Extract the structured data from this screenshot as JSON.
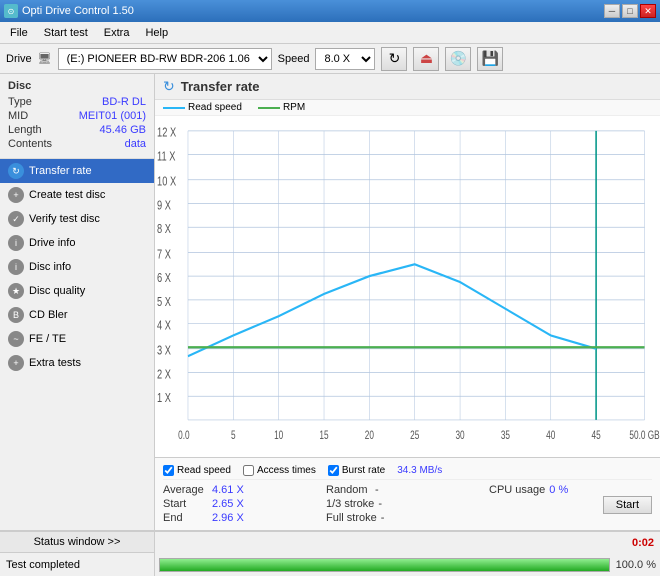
{
  "titlebar": {
    "title": "Opti Drive Control 1.50",
    "icon": "ODC",
    "minimize": "─",
    "restore": "□",
    "close": "✕"
  },
  "menu": {
    "items": [
      "File",
      "Start test",
      "Extra",
      "Help"
    ]
  },
  "drivebar": {
    "drive_label": "Drive",
    "drive_value": "(E:)  PIONEER BD-RW  BDR-206 1.06",
    "speed_label": "Speed",
    "speed_value": "8.0 X"
  },
  "disc": {
    "title": "Disc",
    "type_label": "Type",
    "type_value": "BD-R DL",
    "mid_label": "MID",
    "mid_value": "MEIT01 (001)",
    "length_label": "Length",
    "length_value": "45.46 GB",
    "contents_label": "Contents",
    "contents_value": "data"
  },
  "nav": {
    "items": [
      {
        "label": "Transfer rate",
        "active": true
      },
      {
        "label": "Create test disc",
        "active": false
      },
      {
        "label": "Verify test disc",
        "active": false
      },
      {
        "label": "Drive info",
        "active": false
      },
      {
        "label": "Disc info",
        "active": false
      },
      {
        "label": "Disc quality",
        "active": false
      },
      {
        "label": "CD Bler",
        "active": false
      },
      {
        "label": "FE / TE",
        "active": false
      },
      {
        "label": "Extra tests",
        "active": false
      }
    ]
  },
  "chart": {
    "title": "Transfer rate",
    "legend_read": "Read speed",
    "legend_rpm": "RPM",
    "y_labels": [
      "12 X",
      "11 X",
      "10 X",
      "9 X",
      "8 X",
      "7 X",
      "6 X",
      "5 X",
      "4 X",
      "3 X",
      "2 X",
      "1 X"
    ],
    "x_labels": [
      "0.0",
      "5",
      "10",
      "15",
      "20",
      "25",
      "30",
      "35",
      "40",
      "45",
      "50.0 GB"
    ]
  },
  "checkboxes": {
    "read_speed": {
      "label": "Read speed",
      "checked": true
    },
    "access_times": {
      "label": "Access times",
      "checked": false
    },
    "burst_rate": {
      "label": "Burst rate",
      "checked": true,
      "value": "34.3 MB/s"
    }
  },
  "stats": {
    "average_label": "Average",
    "average_value": "4.61 X",
    "random_label": "Random",
    "random_value": "-",
    "cpu_label": "CPU usage",
    "cpu_value": "0 %",
    "start_label": "Start",
    "start_value": "2.65 X",
    "stroke1_label": "1/3 stroke",
    "stroke1_value": "-",
    "end_label": "End",
    "end_value": "2.96 X",
    "fullstroke_label": "Full stroke",
    "fullstroke_value": "-",
    "start_btn": "Start"
  },
  "statusbar": {
    "btn_label": "Status window >>",
    "time_value": "0:02",
    "status_text": "Test completed",
    "progress_pct": "100.0 %"
  }
}
